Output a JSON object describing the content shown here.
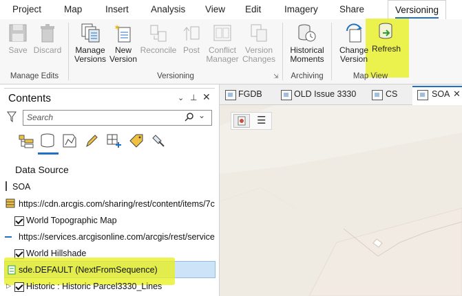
{
  "ribbon_tabs": [
    "Project",
    "Map",
    "Insert",
    "Analysis",
    "View",
    "Edit",
    "Imagery",
    "Share",
    "Versioning"
  ],
  "ribbon": {
    "save": "Save",
    "discard": "Discard",
    "manage_versions": [
      "Manage",
      "Versions"
    ],
    "new_version": [
      "New",
      "Version"
    ],
    "reconcile": "Reconcile",
    "post": "Post",
    "conflict_manager": [
      "Conflict",
      "Manager"
    ],
    "version_changes": [
      "Version",
      "Changes"
    ],
    "historical_moments": [
      "Historical",
      "Moments"
    ],
    "change_version": [
      "Change",
      "Version"
    ],
    "refresh": "Refresh",
    "groups": {
      "manage_edits": "Manage Edits",
      "versioning": "Versioning",
      "archiving": "Archiving",
      "map_view": "Map View"
    }
  },
  "contents": {
    "title": "Contents",
    "search_placeholder": "Search",
    "data_source_label": "Data Source",
    "rows": [
      "SOA",
      "https://cdn.arcgis.com/sharing/rest/content/items/7c",
      "World Topographic Map",
      "https://services.arcgisonline.com/arcgis/rest/services/",
      "World Hillshade",
      "sde.DEFAULT (NextFromSequence)",
      "Historic : Historic Parcel3330_Lines"
    ]
  },
  "map_tabs": [
    "FGDB",
    "OLD Issue 3330",
    "CS",
    "SOA"
  ],
  "colors": {
    "accent": "#1f6fc5",
    "highlight": "#e8f01e",
    "selected_row": "#cde3f7"
  }
}
